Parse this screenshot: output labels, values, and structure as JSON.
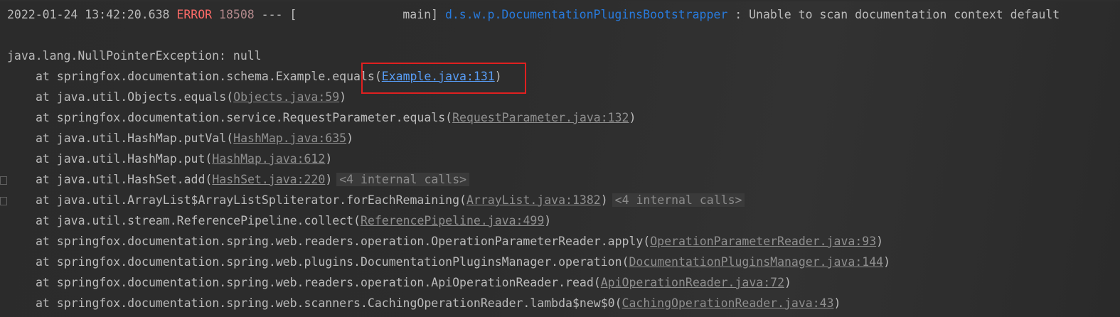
{
  "header": {
    "timestamp": "2022-01-24 13:42:20.638",
    "level": "ERROR",
    "pid": "18508",
    "sep": "--- [",
    "thread": "main]",
    "logger": "d.s.w.p.DocumentationPluginsBootstrapper",
    "message": ": Unable to scan documentation context default"
  },
  "exception": "java.lang.NullPointerException: null",
  "frames": [
    {
      "at": "at springfox.documentation.schema.Example.equals(",
      "link": "Example.java:131",
      "tail": ")",
      "internal": ""
    },
    {
      "at": "at java.util.Objects.equals(",
      "link": "Objects.java:59",
      "tail": ")",
      "internal": ""
    },
    {
      "at": "at springfox.documentation.service.RequestParameter.equals(",
      "link": "RequestParameter.java:132",
      "tail": ")",
      "internal": ""
    },
    {
      "at": "at java.util.HashMap.putVal(",
      "link": "HashMap.java:635",
      "tail": ")",
      "internal": ""
    },
    {
      "at": "at java.util.HashMap.put(",
      "link": "HashMap.java:612",
      "tail": ")",
      "internal": ""
    },
    {
      "at": "at java.util.HashSet.add(",
      "link": "HashSet.java:220",
      "tail": ")",
      "internal": "<4 internal calls>"
    },
    {
      "at": "at java.util.ArrayList$ArrayListSpliterator.forEachRemaining(",
      "link": "ArrayList.java:1382",
      "tail": ")",
      "internal": "<4 internal calls>"
    },
    {
      "at": "at java.util.stream.ReferencePipeline.collect(",
      "link": "ReferencePipeline.java:499",
      "tail": ")",
      "internal": ""
    },
    {
      "at": "at springfox.documentation.spring.web.readers.operation.OperationParameterReader.apply(",
      "link": "OperationParameterReader.java:93",
      "tail": ")",
      "internal": ""
    },
    {
      "at": "at springfox.documentation.spring.web.plugins.DocumentationPluginsManager.operation(",
      "link": "DocumentationPluginsManager.java:144",
      "tail": ")",
      "internal": ""
    },
    {
      "at": "at springfox.documentation.spring.web.readers.operation.ApiOperationReader.read(",
      "link": "ApiOperationReader.java:72",
      "tail": ")",
      "internal": ""
    },
    {
      "at": "at springfox.documentation.spring.web.scanners.CachingOperationReader.lambda$new$0(",
      "link": "CachingOperationReader.java:43",
      "tail": ")",
      "internal": ""
    }
  ],
  "colors": {
    "background": "#2b2b2b",
    "text": "#bbbbbb",
    "error": "#ff6b68",
    "logger": "#287bde",
    "link": "#8f8f8f",
    "highlight_border": "#e02020"
  }
}
